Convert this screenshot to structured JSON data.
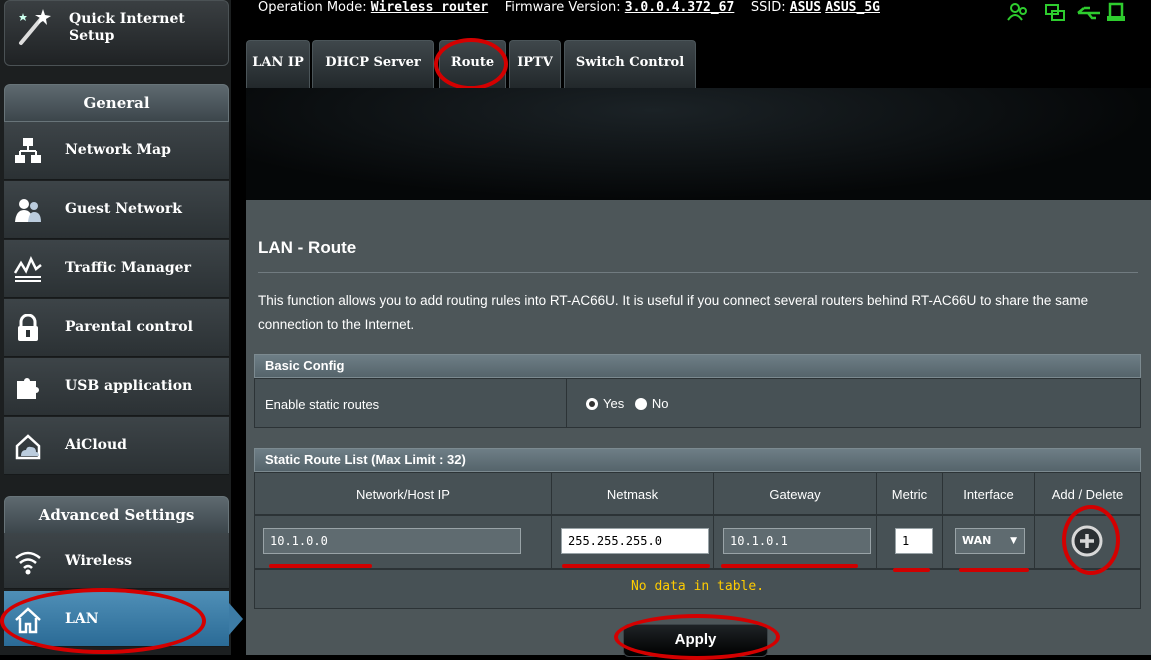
{
  "sidebar": {
    "quick_setup": "Quick Internet Setup",
    "general_header": "General",
    "general_items": [
      {
        "label": "Network Map",
        "icon": "network-map-icon"
      },
      {
        "label": "Guest Network",
        "icon": "guest-network-icon"
      },
      {
        "label": "Traffic Manager",
        "icon": "traffic-manager-icon"
      },
      {
        "label": "Parental control",
        "icon": "parental-control-icon"
      },
      {
        "label": "USB application",
        "icon": "usb-application-icon"
      },
      {
        "label": "AiCloud",
        "icon": "aicloud-icon"
      }
    ],
    "advanced_header": "Advanced Settings",
    "advanced_items": [
      {
        "label": "Wireless",
        "icon": "wireless-icon"
      },
      {
        "label": "LAN",
        "icon": "home-icon",
        "active": true
      }
    ]
  },
  "topbar": {
    "mode_label": "Operation Mode:",
    "mode_value": "Wireless router",
    "fw_label": "Firmware Version:",
    "fw_value": "3.0.0.4.372_67",
    "ssid_label": "SSID:",
    "ssid_1": "ASUS",
    "ssid_2": "ASUS_5G",
    "status_icons": [
      "clients-icon",
      "network-status-icon",
      "usb-status-icon",
      "printer-status-icon"
    ]
  },
  "tabs": [
    {
      "label": "LAN IP"
    },
    {
      "label": "DHCP Server"
    },
    {
      "label": "Route",
      "active": true
    },
    {
      "label": "IPTV"
    },
    {
      "label": "Switch Control"
    }
  ],
  "page": {
    "title": "LAN - Route",
    "description": "This function allows you to add routing rules into RT-AC66U. It is useful if you connect several routers behind RT-AC66U to share the same connection to the Internet."
  },
  "basic_config": {
    "header": "Basic Config",
    "enable_label": "Enable static routes",
    "option_yes": "Yes",
    "option_no": "No",
    "selected": "Yes"
  },
  "route_list": {
    "header": "Static Route List (Max Limit : 32)",
    "columns": [
      "Network/Host IP",
      "Netmask",
      "Gateway",
      "Metric",
      "Interface",
      "Add / Delete"
    ],
    "new_entry": {
      "ip": "10.1.0.0",
      "netmask": "255.255.255.0",
      "gateway": "10.1.0.1",
      "metric": "1",
      "interface": "WAN"
    },
    "empty_text": "No data in table."
  },
  "apply_label": "Apply",
  "colors": {
    "annotation_red": "#d40000",
    "status_green": "#2ecc2e",
    "active_blue": "#2b6b96",
    "empty_text": "#ffcc00"
  }
}
